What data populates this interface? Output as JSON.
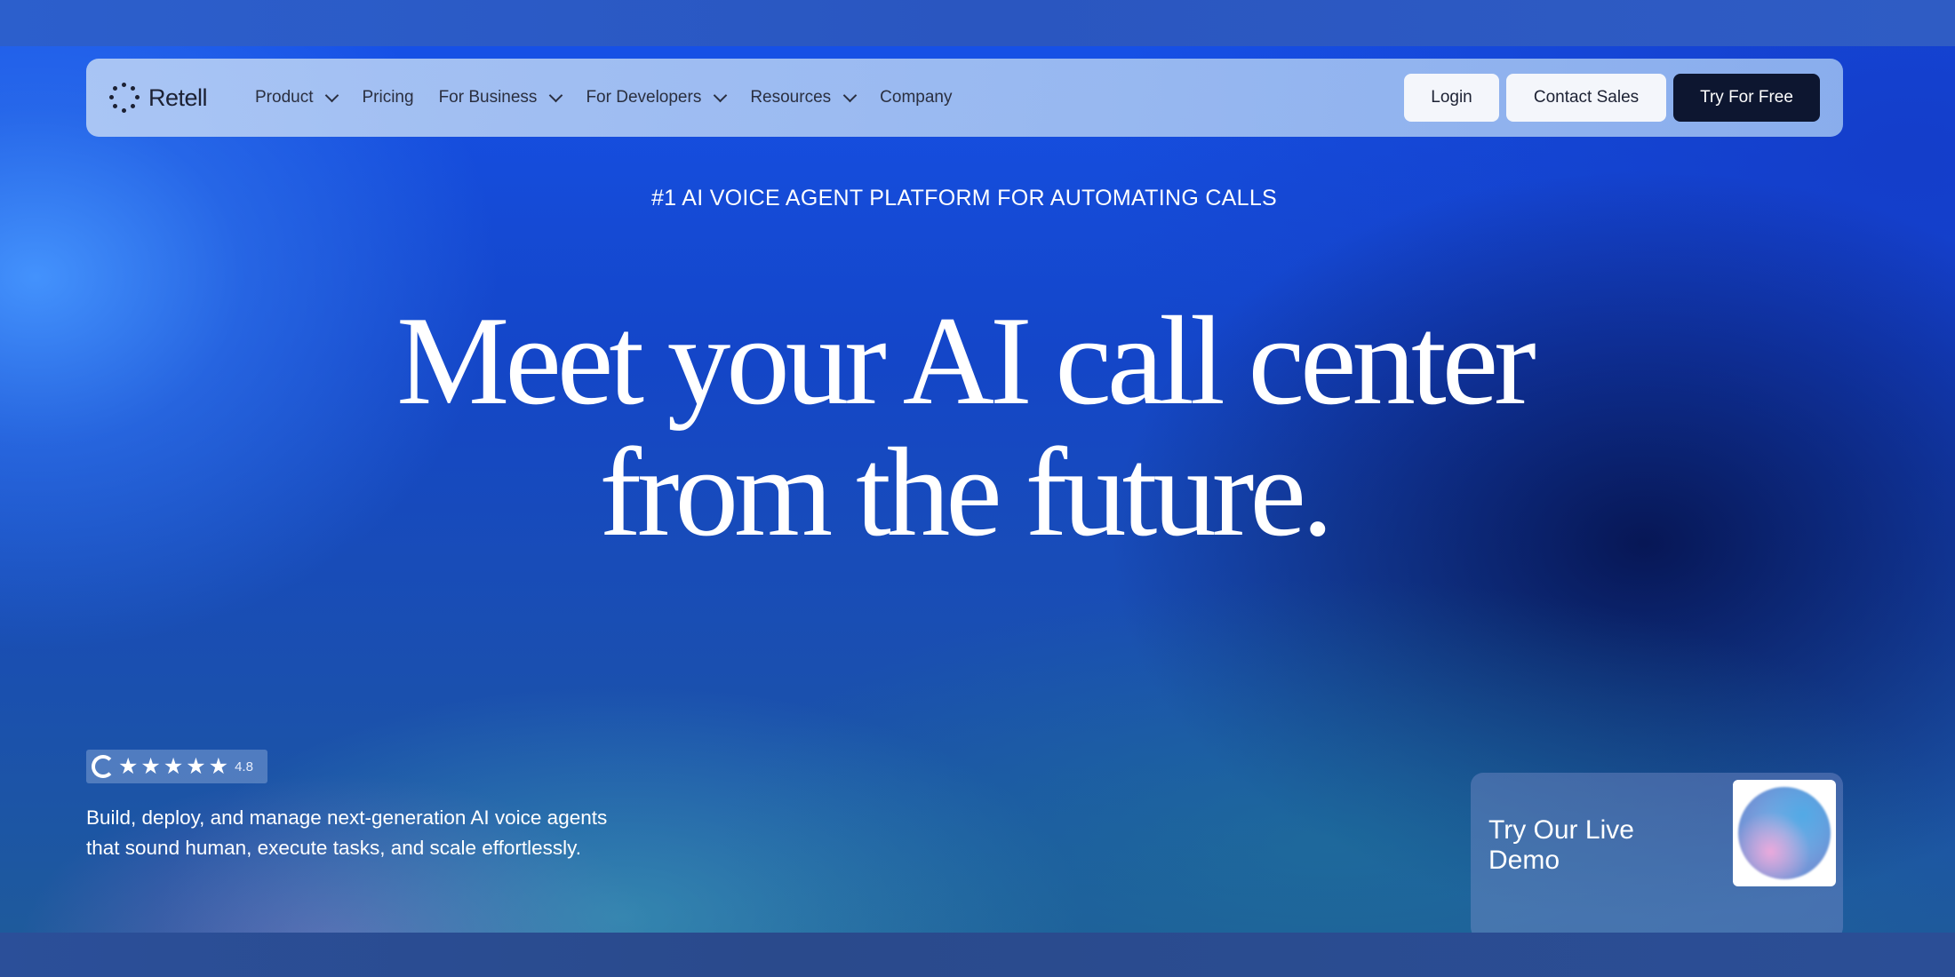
{
  "nav": {
    "logo_text": "Retell",
    "items": [
      {
        "label": "Product",
        "has_dropdown": true
      },
      {
        "label": "Pricing",
        "has_dropdown": false
      },
      {
        "label": "For Business",
        "has_dropdown": true
      },
      {
        "label": "For Developers",
        "has_dropdown": true
      },
      {
        "label": "Resources",
        "has_dropdown": true
      },
      {
        "label": "Company",
        "has_dropdown": false
      }
    ],
    "login_label": "Login",
    "contact_label": "Contact Sales",
    "try_label": "Try For Free"
  },
  "hero": {
    "eyebrow": "#1 AI VOICE AGENT PLATFORM FOR AUTOMATING CALLS",
    "headline_line1": "Meet your AI call center",
    "headline_line2": "from the future.",
    "rating": {
      "stars": "★★★★★",
      "score": "4.8",
      "icon": "g2-icon"
    },
    "subtext": "Build, deploy, and manage next-generation AI voice agents that sound human, execute tasks, and scale effortlessly."
  },
  "demo_card": {
    "label": "Try Our Live Demo"
  },
  "colors": {
    "dark_button": "#0d1630",
    "light_button": "#f4f6fb",
    "navbar_bg": "#b4cdf5",
    "hero_blue": "#1650e6"
  }
}
